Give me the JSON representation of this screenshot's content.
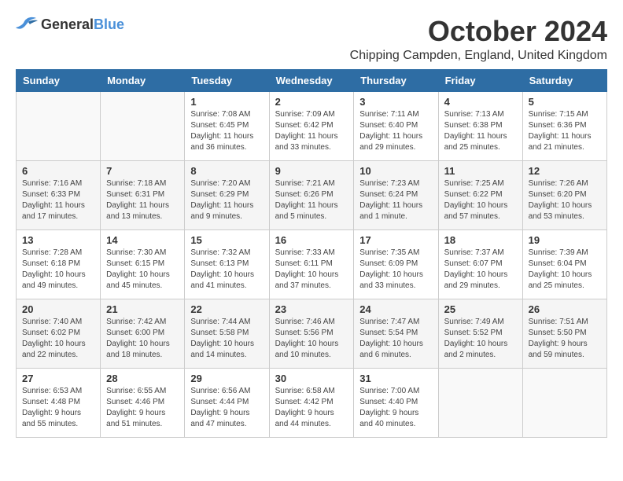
{
  "logo": {
    "general": "General",
    "blue": "Blue"
  },
  "header": {
    "month": "October 2024",
    "location": "Chipping Campden, England, United Kingdom"
  },
  "weekdays": [
    "Sunday",
    "Monday",
    "Tuesday",
    "Wednesday",
    "Thursday",
    "Friday",
    "Saturday"
  ],
  "weeks": [
    [
      {
        "day": "",
        "sunrise": "",
        "sunset": "",
        "daylight": ""
      },
      {
        "day": "",
        "sunrise": "",
        "sunset": "",
        "daylight": ""
      },
      {
        "day": "1",
        "sunrise": "Sunrise: 7:08 AM",
        "sunset": "Sunset: 6:45 PM",
        "daylight": "Daylight: 11 hours and 36 minutes."
      },
      {
        "day": "2",
        "sunrise": "Sunrise: 7:09 AM",
        "sunset": "Sunset: 6:42 PM",
        "daylight": "Daylight: 11 hours and 33 minutes."
      },
      {
        "day": "3",
        "sunrise": "Sunrise: 7:11 AM",
        "sunset": "Sunset: 6:40 PM",
        "daylight": "Daylight: 11 hours and 29 minutes."
      },
      {
        "day": "4",
        "sunrise": "Sunrise: 7:13 AM",
        "sunset": "Sunset: 6:38 PM",
        "daylight": "Daylight: 11 hours and 25 minutes."
      },
      {
        "day": "5",
        "sunrise": "Sunrise: 7:15 AM",
        "sunset": "Sunset: 6:36 PM",
        "daylight": "Daylight: 11 hours and 21 minutes."
      }
    ],
    [
      {
        "day": "6",
        "sunrise": "Sunrise: 7:16 AM",
        "sunset": "Sunset: 6:33 PM",
        "daylight": "Daylight: 11 hours and 17 minutes."
      },
      {
        "day": "7",
        "sunrise": "Sunrise: 7:18 AM",
        "sunset": "Sunset: 6:31 PM",
        "daylight": "Daylight: 11 hours and 13 minutes."
      },
      {
        "day": "8",
        "sunrise": "Sunrise: 7:20 AM",
        "sunset": "Sunset: 6:29 PM",
        "daylight": "Daylight: 11 hours and 9 minutes."
      },
      {
        "day": "9",
        "sunrise": "Sunrise: 7:21 AM",
        "sunset": "Sunset: 6:26 PM",
        "daylight": "Daylight: 11 hours and 5 minutes."
      },
      {
        "day": "10",
        "sunrise": "Sunrise: 7:23 AM",
        "sunset": "Sunset: 6:24 PM",
        "daylight": "Daylight: 11 hours and 1 minute."
      },
      {
        "day": "11",
        "sunrise": "Sunrise: 7:25 AM",
        "sunset": "Sunset: 6:22 PM",
        "daylight": "Daylight: 10 hours and 57 minutes."
      },
      {
        "day": "12",
        "sunrise": "Sunrise: 7:26 AM",
        "sunset": "Sunset: 6:20 PM",
        "daylight": "Daylight: 10 hours and 53 minutes."
      }
    ],
    [
      {
        "day": "13",
        "sunrise": "Sunrise: 7:28 AM",
        "sunset": "Sunset: 6:18 PM",
        "daylight": "Daylight: 10 hours and 49 minutes."
      },
      {
        "day": "14",
        "sunrise": "Sunrise: 7:30 AM",
        "sunset": "Sunset: 6:15 PM",
        "daylight": "Daylight: 10 hours and 45 minutes."
      },
      {
        "day": "15",
        "sunrise": "Sunrise: 7:32 AM",
        "sunset": "Sunset: 6:13 PM",
        "daylight": "Daylight: 10 hours and 41 minutes."
      },
      {
        "day": "16",
        "sunrise": "Sunrise: 7:33 AM",
        "sunset": "Sunset: 6:11 PM",
        "daylight": "Daylight: 10 hours and 37 minutes."
      },
      {
        "day": "17",
        "sunrise": "Sunrise: 7:35 AM",
        "sunset": "Sunset: 6:09 PM",
        "daylight": "Daylight: 10 hours and 33 minutes."
      },
      {
        "day": "18",
        "sunrise": "Sunrise: 7:37 AM",
        "sunset": "Sunset: 6:07 PM",
        "daylight": "Daylight: 10 hours and 29 minutes."
      },
      {
        "day": "19",
        "sunrise": "Sunrise: 7:39 AM",
        "sunset": "Sunset: 6:04 PM",
        "daylight": "Daylight: 10 hours and 25 minutes."
      }
    ],
    [
      {
        "day": "20",
        "sunrise": "Sunrise: 7:40 AM",
        "sunset": "Sunset: 6:02 PM",
        "daylight": "Daylight: 10 hours and 22 minutes."
      },
      {
        "day": "21",
        "sunrise": "Sunrise: 7:42 AM",
        "sunset": "Sunset: 6:00 PM",
        "daylight": "Daylight: 10 hours and 18 minutes."
      },
      {
        "day": "22",
        "sunrise": "Sunrise: 7:44 AM",
        "sunset": "Sunset: 5:58 PM",
        "daylight": "Daylight: 10 hours and 14 minutes."
      },
      {
        "day": "23",
        "sunrise": "Sunrise: 7:46 AM",
        "sunset": "Sunset: 5:56 PM",
        "daylight": "Daylight: 10 hours and 10 minutes."
      },
      {
        "day": "24",
        "sunrise": "Sunrise: 7:47 AM",
        "sunset": "Sunset: 5:54 PM",
        "daylight": "Daylight: 10 hours and 6 minutes."
      },
      {
        "day": "25",
        "sunrise": "Sunrise: 7:49 AM",
        "sunset": "Sunset: 5:52 PM",
        "daylight": "Daylight: 10 hours and 2 minutes."
      },
      {
        "day": "26",
        "sunrise": "Sunrise: 7:51 AM",
        "sunset": "Sunset: 5:50 PM",
        "daylight": "Daylight: 9 hours and 59 minutes."
      }
    ],
    [
      {
        "day": "27",
        "sunrise": "Sunrise: 6:53 AM",
        "sunset": "Sunset: 4:48 PM",
        "daylight": "Daylight: 9 hours and 55 minutes."
      },
      {
        "day": "28",
        "sunrise": "Sunrise: 6:55 AM",
        "sunset": "Sunset: 4:46 PM",
        "daylight": "Daylight: 9 hours and 51 minutes."
      },
      {
        "day": "29",
        "sunrise": "Sunrise: 6:56 AM",
        "sunset": "Sunset: 4:44 PM",
        "daylight": "Daylight: 9 hours and 47 minutes."
      },
      {
        "day": "30",
        "sunrise": "Sunrise: 6:58 AM",
        "sunset": "Sunset: 4:42 PM",
        "daylight": "Daylight: 9 hours and 44 minutes."
      },
      {
        "day": "31",
        "sunrise": "Sunrise: 7:00 AM",
        "sunset": "Sunset: 4:40 PM",
        "daylight": "Daylight: 9 hours and 40 minutes."
      },
      {
        "day": "",
        "sunrise": "",
        "sunset": "",
        "daylight": ""
      },
      {
        "day": "",
        "sunrise": "",
        "sunset": "",
        "daylight": ""
      }
    ]
  ]
}
